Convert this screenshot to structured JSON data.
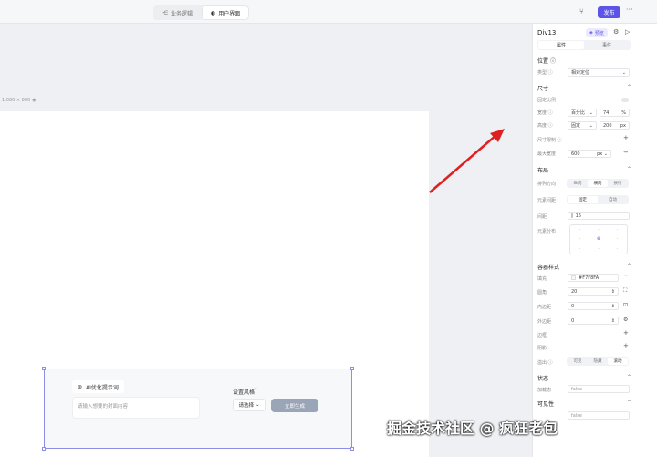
{
  "topbar": {
    "tabs": [
      {
        "label": "业务逻辑",
        "icon": "share-icon",
        "active": false
      },
      {
        "label": "用户界面",
        "icon": "palette-icon",
        "active": true
      }
    ],
    "publish_label": "发布",
    "more_label": "···"
  },
  "canvas": {
    "size_label": "1,080 × 800"
  },
  "component": {
    "ai_button_label": "AI优化提示词",
    "cover_placeholder": "请输入想要的封面内容",
    "style_label": "设置风格",
    "style_required": "*",
    "style_select_value": "请选择",
    "generate_label": "立即生成"
  },
  "panel": {
    "title": "Div13",
    "preview_label": "预览",
    "tabs": [
      "属性",
      "事件"
    ],
    "position": {
      "section": "位置",
      "type_label": "类型",
      "type_value": "相对定位"
    },
    "size": {
      "section": "尺寸",
      "fixed_label": "固定比例",
      "width_label": "宽度",
      "width_mode": "百分比",
      "width_value": "74",
      "width_unit": "%",
      "height_label": "高度",
      "height_mode": "固定",
      "height_value": "200",
      "height_unit": "px",
      "limit_label": "尺寸限制",
      "max_width_label": "最大宽度",
      "max_width_value": "600",
      "max_width_unit": "px"
    },
    "layout": {
      "section": "布局",
      "direction_label": "排列方向",
      "direction_options": [
        "纵向",
        "横向",
        "换行"
      ],
      "direction_selected": 1,
      "spacing_label": "元素间距",
      "spacing_options": [
        "固定",
        "自动"
      ],
      "spacing_selected": 0,
      "gap_label": "间距",
      "gap_value": "16",
      "distribution_label": "元素分布"
    },
    "container": {
      "section": "容器样式",
      "fill_label": "填充",
      "fill_value": "#F7F8FA",
      "radius_label": "圆角",
      "radius_value": "20",
      "padding_label": "内边距",
      "padding_value": "0",
      "margin_label": "外边距",
      "margin_value": "0",
      "border_label": "边框",
      "shadow_label": "阴影",
      "overflow_label": "溢出",
      "overflow_options": [
        "可见",
        "隐藏",
        "滚动"
      ],
      "overflow_selected": 2
    },
    "state": {
      "section": "状态",
      "loading_label": "加载态",
      "loading_value": "false"
    },
    "visibility": {
      "section": "可见性",
      "hidden_value": "false"
    }
  },
  "annotation": {
    "arrow_color": "#e02020"
  },
  "watermark": "掘金技术社区 @ 疯狂老包"
}
